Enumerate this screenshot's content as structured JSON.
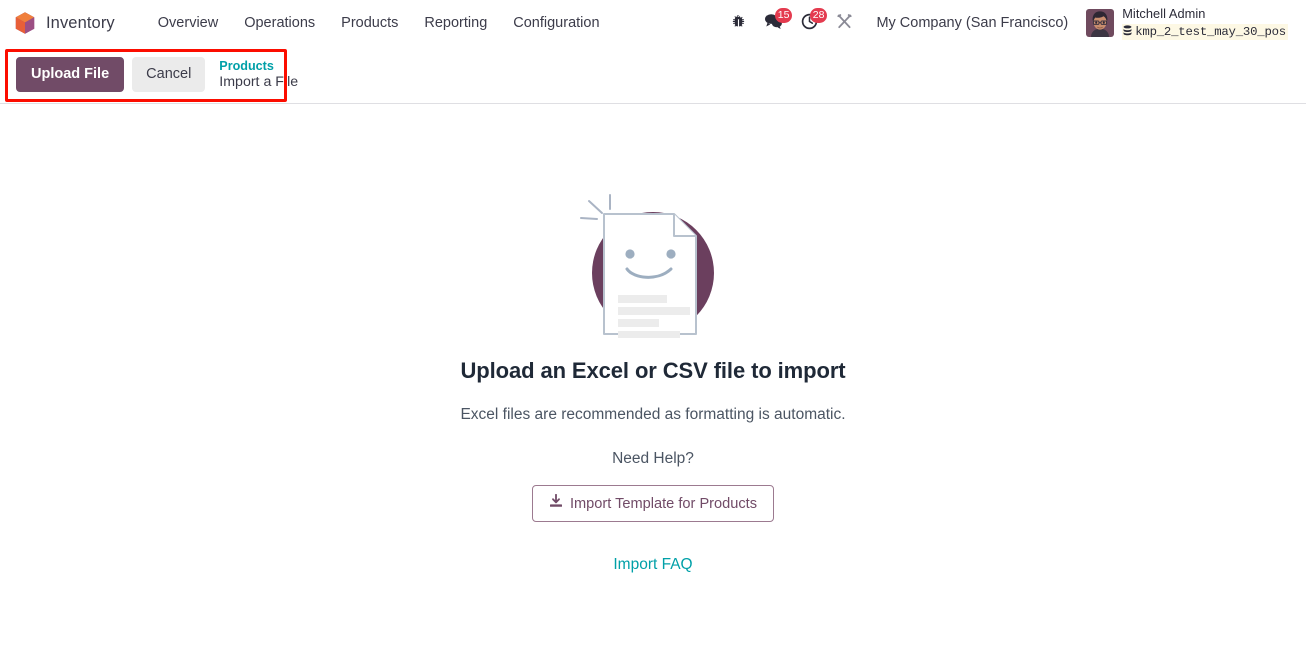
{
  "navbar": {
    "brand": "Inventory",
    "brand_icon": "inventory-box-icon",
    "menu_items": [
      {
        "label": "Overview"
      },
      {
        "label": "Operations"
      },
      {
        "label": "Products"
      },
      {
        "label": "Reporting"
      },
      {
        "label": "Configuration"
      }
    ],
    "systray": {
      "debug_icon": "bug-icon",
      "messages_icon": "chat-bubble-icon",
      "messages_count": "15",
      "activities_icon": "clock-icon",
      "activities_count": "28",
      "tools_icon": "wrench-screwdriver-icon",
      "company": "My Company (San Francisco)",
      "avatar_icon": "user-avatar",
      "user_name": "Mitchell Admin",
      "database_icon": "database-icon",
      "database_name": "kmp_2_test_may_30_pos"
    }
  },
  "control_panel": {
    "upload_label": "Upload File",
    "cancel_label": "Cancel",
    "breadcrumb_parent": "Products",
    "breadcrumb_current": "Import a File"
  },
  "main": {
    "illustration": "smiling-document-icon",
    "headline": "Upload an Excel or CSV file to import",
    "subline": "Excel files are recommended as formatting is automatic.",
    "need_help": "Need Help?",
    "template_icon": "download-icon",
    "template_label": "Import Template for Products",
    "faq_label": "Import FAQ"
  },
  "colors": {
    "primary": "#714b67",
    "link": "#00a0a8",
    "badge": "#e43b4f",
    "annotation": "#fc0d00",
    "illustration_circle": "#6b3f5e"
  }
}
